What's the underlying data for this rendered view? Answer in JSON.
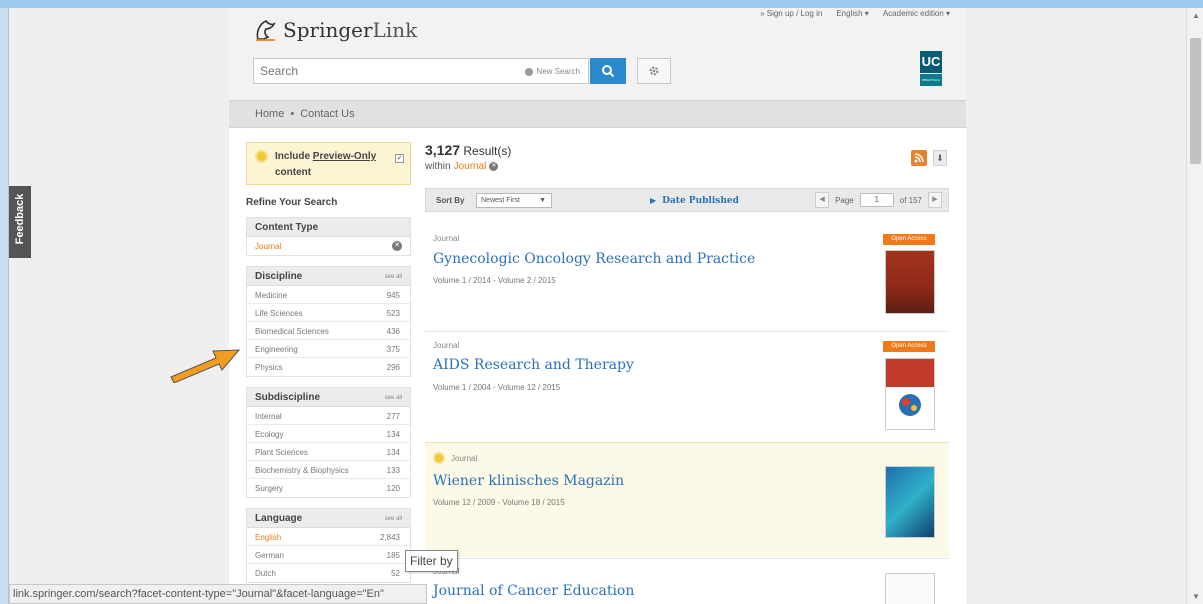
{
  "header": {
    "logo_springer": "Springer",
    "logo_link": "Link",
    "signup": "» Sign up / Log in",
    "language": "English ▾",
    "edition": "Academic edition ▾",
    "search_placeholder": "Search",
    "new_search": "New Search",
    "uc_logo": "UC",
    "uc_subtitle": "BIBLIOTECA"
  },
  "nav": {
    "home": "Home",
    "separator": "•",
    "contact": "Contact Us"
  },
  "feedback": "Feedback",
  "sidebar": {
    "preview_label_1": "Include ",
    "preview_label_2": "Preview-Only",
    "preview_label_3": "content",
    "refine": "Refine Your Search",
    "content_type": {
      "title": "Content Type",
      "active": "Journal"
    },
    "discipline": {
      "title": "Discipline",
      "see_all": "see all",
      "items": [
        {
          "label": "Medicine",
          "count": "945"
        },
        {
          "label": "Life Sciences",
          "count": "523"
        },
        {
          "label": "Biomedical Sciences",
          "count": "436"
        },
        {
          "label": "Engineering",
          "count": "375"
        },
        {
          "label": "Physics",
          "count": "296"
        }
      ]
    },
    "subdiscipline": {
      "title": "Subdiscipline",
      "see_all": "see all",
      "items": [
        {
          "label": "Internal",
          "count": "277"
        },
        {
          "label": "Ecology",
          "count": "134"
        },
        {
          "label": "Plant Sciences",
          "count": "134"
        },
        {
          "label": "Biochemistry & Biophysics",
          "count": "133"
        },
        {
          "label": "Surgery",
          "count": "120"
        }
      ]
    },
    "language": {
      "title": "Language",
      "see_all": "see all",
      "items": [
        {
          "label": "English",
          "count": "2,843"
        },
        {
          "label": "German",
          "count": "185"
        },
        {
          "label": "Dutch",
          "count": "52"
        }
      ]
    }
  },
  "results": {
    "count": "3,127",
    "count_label": " Result(s)",
    "within_label": "within ",
    "within_value": "Journal",
    "sort_by": "Sort By",
    "sort_value": "Newest First",
    "date_published": "Date Published",
    "page_label": "Page",
    "page_value": "1",
    "page_total": "of 157",
    "items": [
      {
        "type": "Journal",
        "title": "Gynecologic Oncology Research and Practice",
        "meta": "Volume 1 / 2014 - Volume 2 / 2015",
        "badge": "Open Access"
      },
      {
        "type": "Journal",
        "title": "AIDS Research and Therapy",
        "meta": "Volume 1 / 2004 - Volume 12 / 2015",
        "badge": "Open Access"
      },
      {
        "type": "Journal",
        "title": "Wiener klinisches Magazin",
        "meta": "Volume 12 / 2009 - Volume 18 / 2015"
      },
      {
        "type": "Journal",
        "title": "Journal of Cancer Education"
      }
    ]
  },
  "status_url": "link.springer.com/search?facet-content-type=\"Journal\"&facet-language=\"En\"",
  "tooltip": "Filter by",
  "colors": {
    "accent_blue": "#2b8acd",
    "link_blue": "#2b72b8",
    "orange": "#ec7b14",
    "preview_yellow": "#fcf5d3"
  }
}
